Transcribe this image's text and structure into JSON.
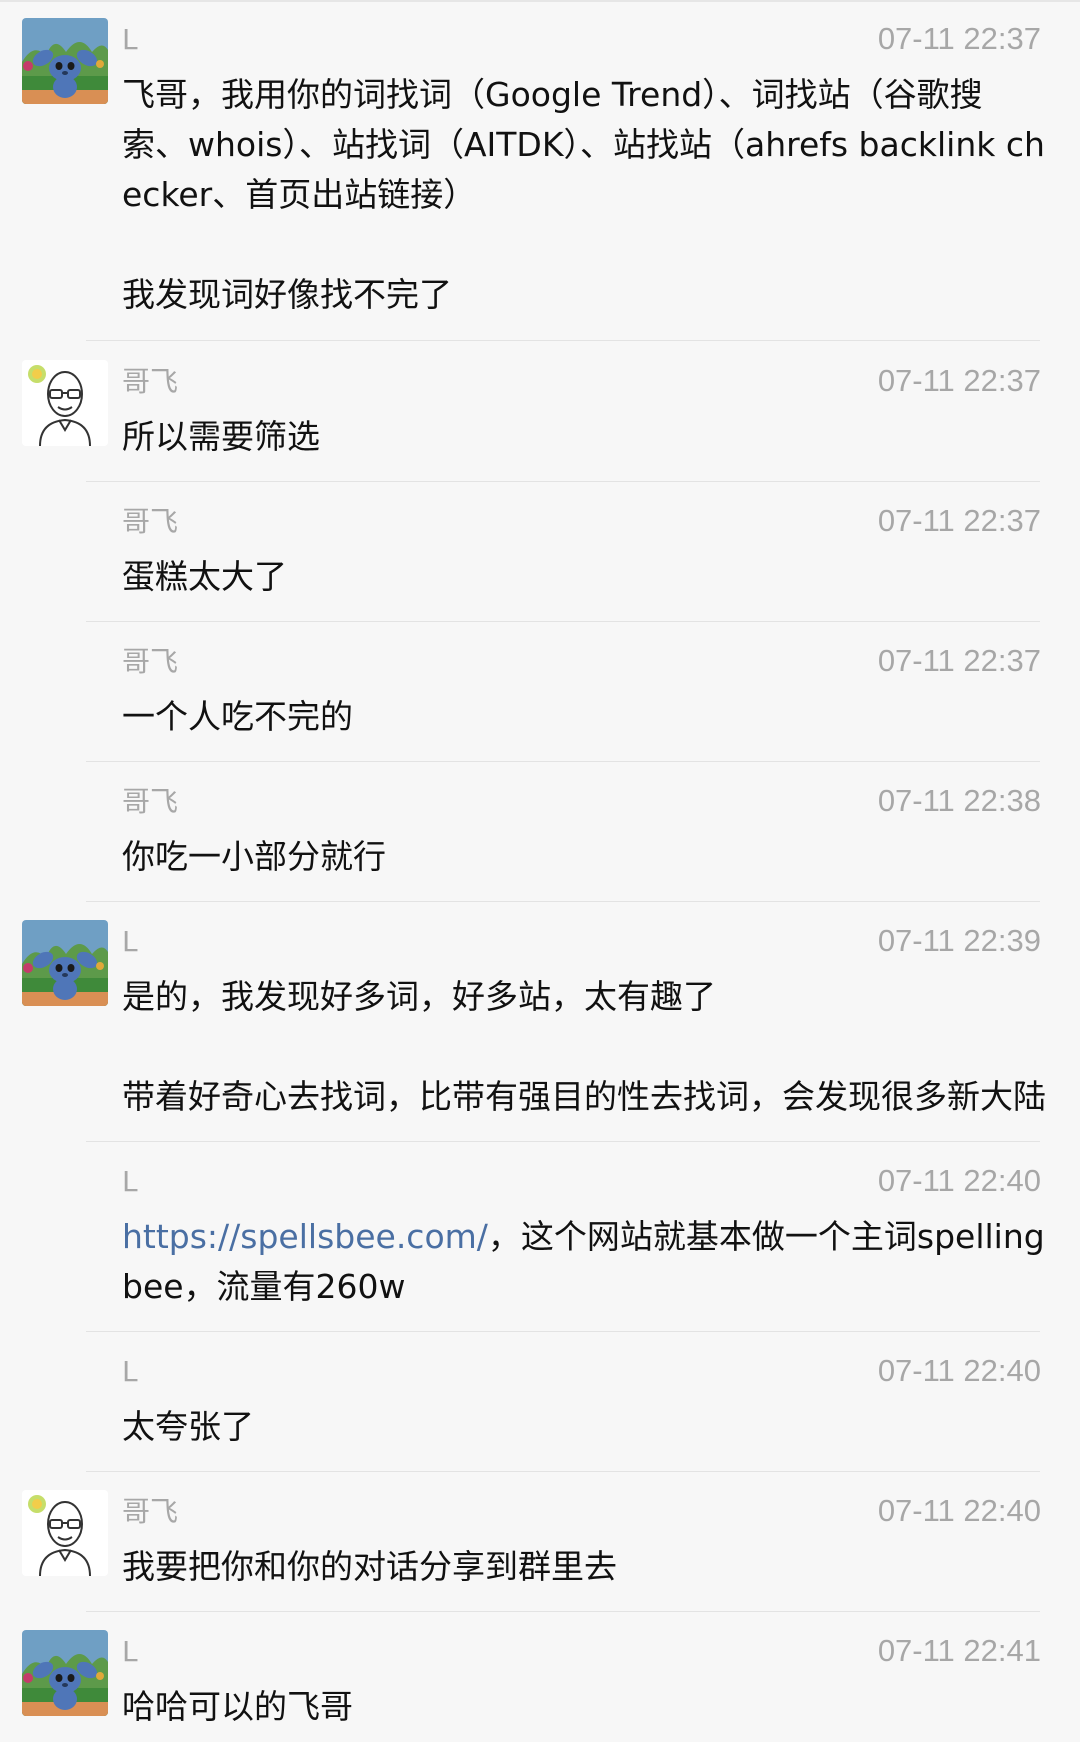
{
  "messages": [
    {
      "sender": "L",
      "time": "07-11 22:37",
      "text": "飞哥，我用你的词找词（Google Trend）、词找站（谷歌搜索、whois）、站找词（AITDK）、站找站（ahrefs backlink checker、首页出站链接）\n\n我发现词好像找不完了",
      "avatar": "stitch-avatar"
    },
    {
      "sender": "哥飞",
      "time": "07-11 22:37",
      "text": "所以需要筛选",
      "avatar": "bald-man-glasses-avatar"
    },
    {
      "sender": "哥飞",
      "time": "07-11 22:37",
      "text": "蛋糕太大了"
    },
    {
      "sender": "哥飞",
      "time": "07-11 22:37",
      "text": "一个人吃不完的"
    },
    {
      "sender": "哥飞",
      "time": "07-11 22:38",
      "text": "你吃一小部分就行"
    },
    {
      "sender": "L",
      "time": "07-11 22:39",
      "text": "是的，我发现好多词，好多站，太有趣了\n\n带着好奇心去找词，比带有强目的性去找词，会发现很多新大陆",
      "avatar": "stitch-avatar"
    },
    {
      "sender": "L",
      "time": "07-11 22:40",
      "link": "https://spellsbee.com/",
      "text": "，这个网站就基本做一个主词spelling bee，流量有260w"
    },
    {
      "sender": "L",
      "time": "07-11 22:40",
      "text": "太夸张了"
    },
    {
      "sender": "哥飞",
      "time": "07-11 22:40",
      "text": "我要把你和你的对话分享到群里去",
      "avatar": "bald-man-glasses-avatar"
    },
    {
      "sender": "L",
      "time": "07-11 22:41",
      "text": "哈哈可以的飞哥",
      "avatar": "stitch-avatar"
    }
  ]
}
